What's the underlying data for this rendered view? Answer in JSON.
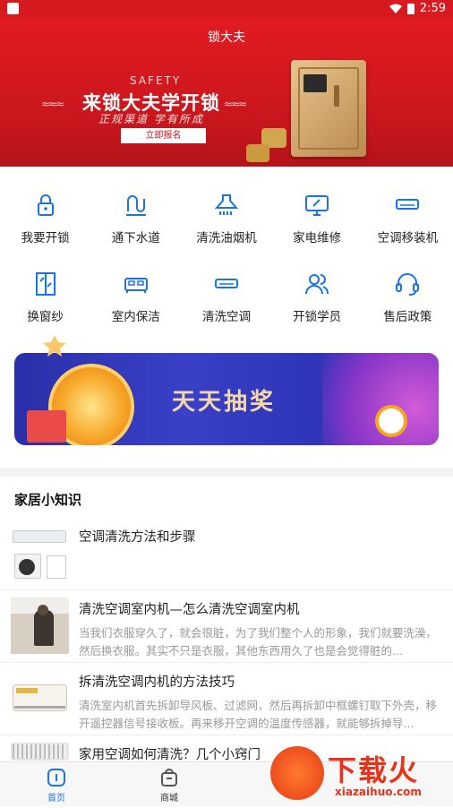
{
  "status_bar": {
    "time": "2:59"
  },
  "header": {
    "title": "锁大夫",
    "banner": {
      "eyebrow": "SAFETY",
      "headline": "来锁大夫学开锁",
      "sub": "正规渠道  学有所成",
      "cta": "立即报名"
    }
  },
  "services": [
    {
      "label": "我要开锁",
      "icon": "lock-icon"
    },
    {
      "label": "通下水道",
      "icon": "pipe-icon"
    },
    {
      "label": "清洗油烟机",
      "icon": "range-hood-icon"
    },
    {
      "label": "家电维修",
      "icon": "monitor-repair-icon"
    },
    {
      "label": "空调移装机",
      "icon": "air-conditioner-icon"
    },
    {
      "label": "换窗纱",
      "icon": "window-icon"
    },
    {
      "label": "室内保洁",
      "icon": "bed-icon"
    },
    {
      "label": "清洗空调",
      "icon": "ac-unit-icon"
    },
    {
      "label": "开锁学员",
      "icon": "users-icon"
    },
    {
      "label": "售后政策",
      "icon": "headset-icon"
    }
  ],
  "lottery": {
    "text": "天天抽奖"
  },
  "knowledge": {
    "title": "家居小知识",
    "articles": [
      {
        "title": "空调清洗方法和步骤",
        "desc": ""
      },
      {
        "title": "清洗空调室内机—怎么清洗空调室内机",
        "desc": "当我们衣服穿久了，就会很脏，为了我们整个人的形象，我们就要洗澡，然后换衣服。其实不只是衣服，其他东西用久了也是会觉得脏的..."
      },
      {
        "title": "拆清洗空调内机的方法技巧",
        "desc": "清洗室内机首先拆卸导风板、过滤网，然后再拆卸中框螺钉取下外壳，移开遥控器信号接收板。再来移开空调的温度传感器，就能够拆掉导..."
      },
      {
        "title": "家用空调如何清洗？几个小窍门",
        "desc": ""
      }
    ]
  },
  "tabbar": {
    "tabs": [
      {
        "label": "首页",
        "active": true
      },
      {
        "label": "商城",
        "active": false
      }
    ]
  },
  "watermark": {
    "brand": "下载火",
    "url": "xiazaihuo.com"
  },
  "colors": {
    "brand_red": "#d71920",
    "accent_blue": "#1a73e8"
  }
}
